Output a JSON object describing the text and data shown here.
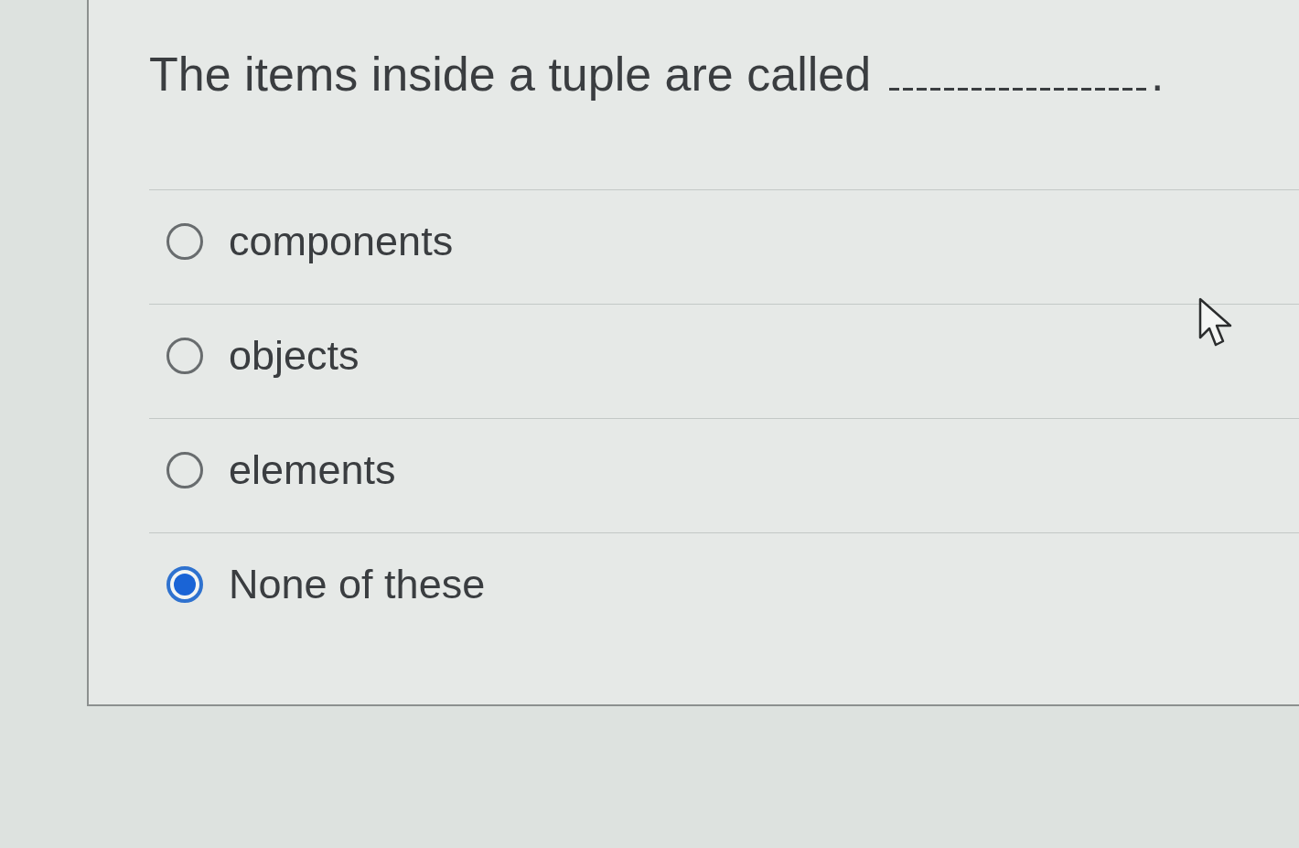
{
  "question": {
    "text": "The items inside a tuple are called",
    "text_after_blank": "."
  },
  "options": [
    {
      "label": "components",
      "selected": false
    },
    {
      "label": "objects",
      "selected": false
    },
    {
      "label": "elements",
      "selected": false
    },
    {
      "label": "None of these",
      "selected": true
    }
  ]
}
